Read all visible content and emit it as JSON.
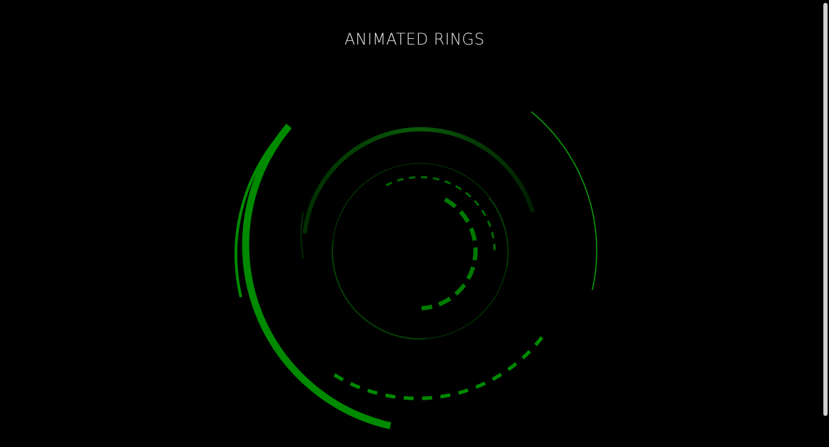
{
  "title": "ANIMATED RINGS",
  "colors": {
    "background": "#000000",
    "ring_primary": "#008a00",
    "ring_dark": "#014d01",
    "title_text": "#e6e6e6"
  }
}
